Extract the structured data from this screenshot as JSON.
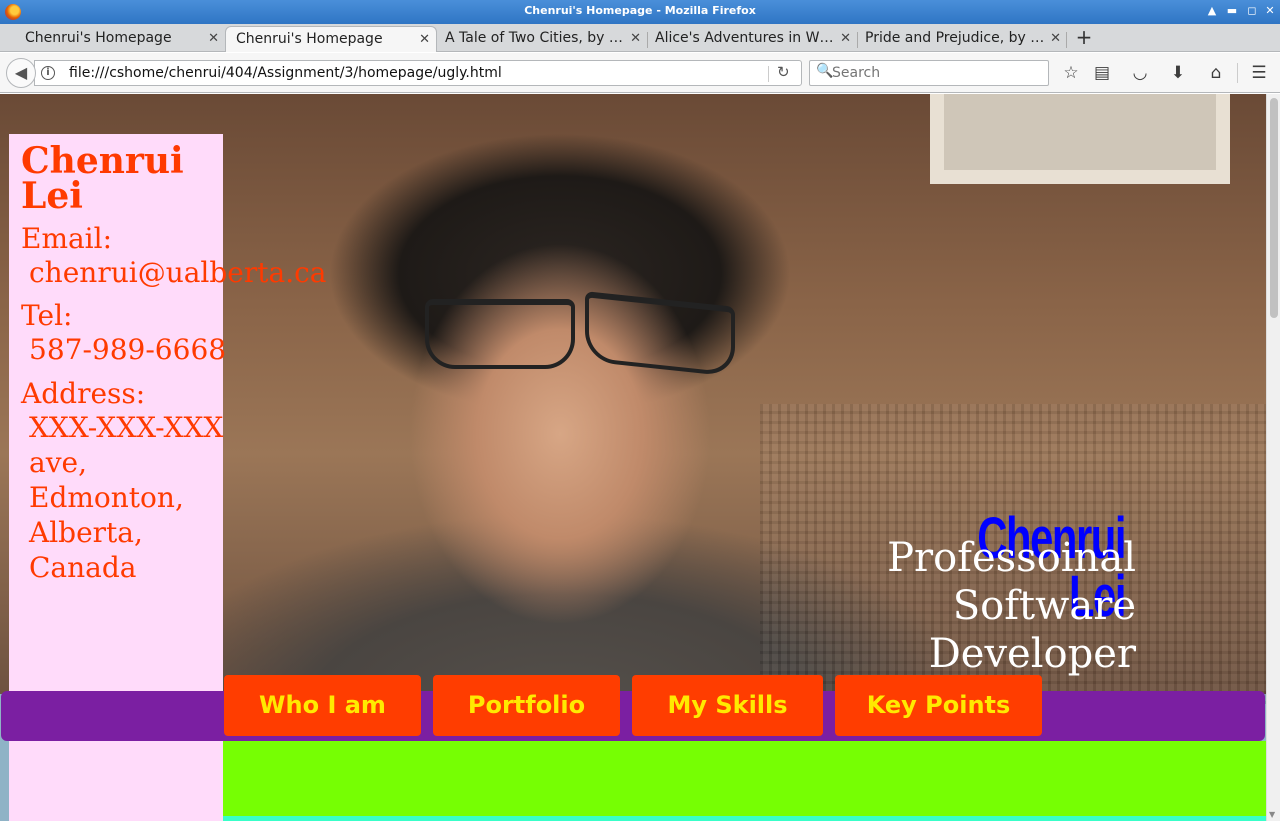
{
  "window": {
    "title": "Chenrui's Homepage - Mozilla Firefox",
    "controls": [
      "▲",
      "▬",
      "◻",
      "✕"
    ]
  },
  "tabs": [
    {
      "title": "Chenrui's Homepage",
      "active": false
    },
    {
      "title": "Chenrui's Homepage",
      "active": true
    },
    {
      "title": "A Tale of Two Cities, by …",
      "active": false
    },
    {
      "title": "Alice's Adventures in W…",
      "active": false
    },
    {
      "title": "Pride and Prejudice, by J…",
      "active": false
    }
  ],
  "toolbar": {
    "url": "file:///cshome/chenrui/404/Assignment/3/homepage/ugly.html",
    "search_placeholder": "Search",
    "icons": [
      "bookmark-star-icon",
      "reading-list-icon",
      "pocket-icon",
      "downloads-icon",
      "home-icon",
      "menu-icon"
    ]
  },
  "page": {
    "sidebar": {
      "name": "Chenrui Lei",
      "email_label": "Email:",
      "email": "chenrui@ualberta.ca",
      "tel_label": "Tel:",
      "tel": "587-989-6668",
      "address_label": "Address:",
      "address_lines": [
        "XXX-XXX-XXX",
        "ave,",
        "Edmonton,",
        "Alberta,",
        "Canada"
      ]
    },
    "hero": {
      "name_lines": [
        "Chenrui",
        "Lei"
      ],
      "tagline_lines": [
        "Professoinal",
        "Software",
        "Developer"
      ]
    },
    "nav": [
      "Who I am",
      "Portfolio",
      "My Skills",
      "Key Points"
    ]
  },
  "colors": {
    "sidebar_bg": "#ffdbfa",
    "sidebar_text": "#ff3a00",
    "nav_strip": "#7b1fa2",
    "nav_button": "#ff3d00",
    "nav_text": "#ffea00",
    "hero_name": "#0000ff",
    "green_section": "#76ff03"
  }
}
